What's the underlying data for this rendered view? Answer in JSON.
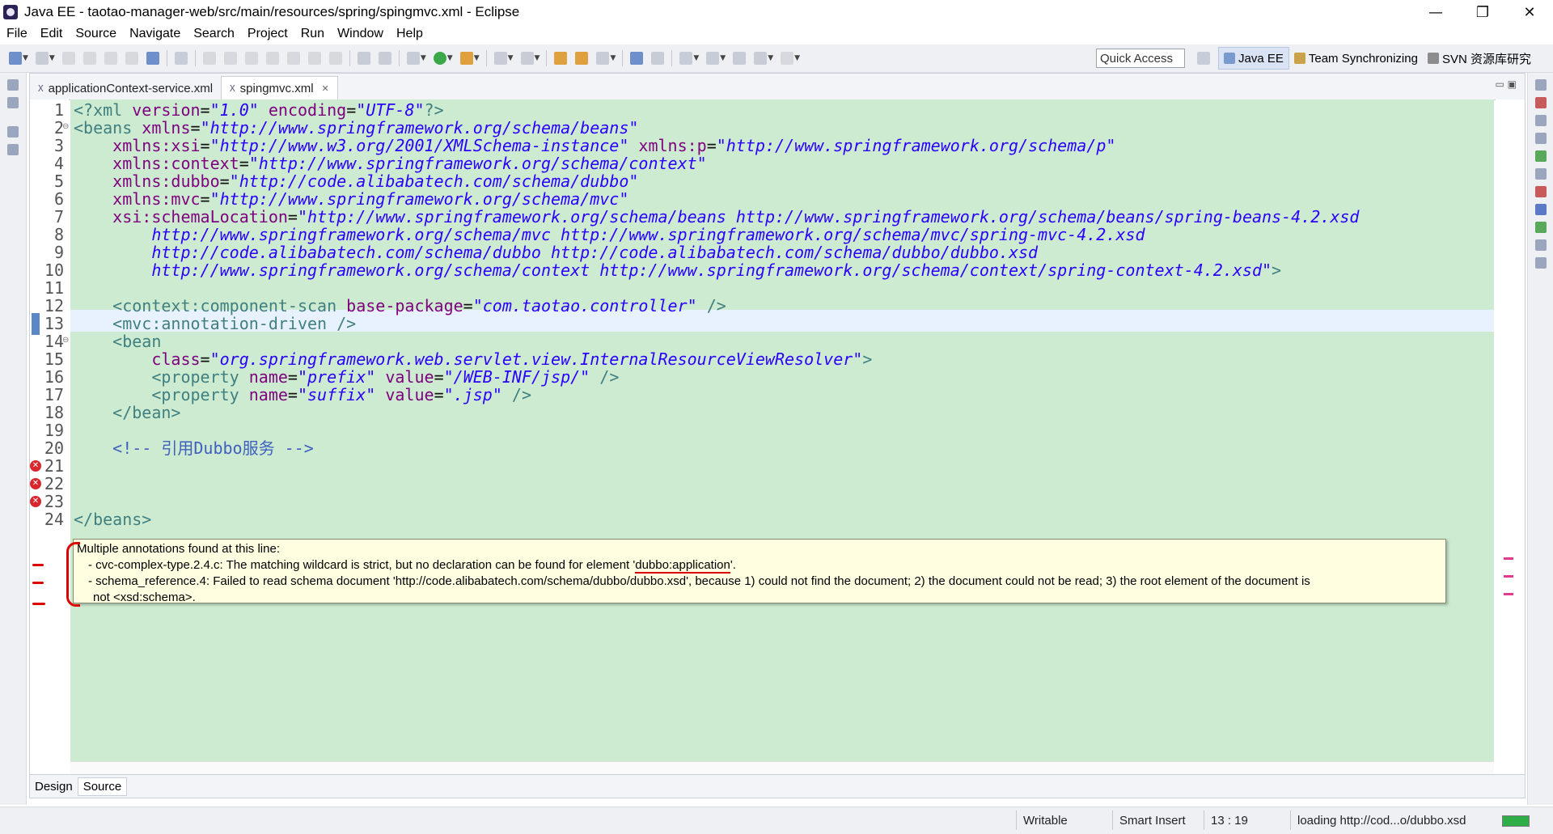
{
  "window": {
    "title": "Java EE - taotao-manager-web/src/main/resources/spring/spingmvc.xml - Eclipse",
    "controls": [
      "—",
      "❐",
      "✕"
    ]
  },
  "menu": [
    "File",
    "Edit",
    "Source",
    "Navigate",
    "Search",
    "Project",
    "Run",
    "Window",
    "Help"
  ],
  "toolbar": {
    "quick_access": "Quick Access",
    "perspectives": [
      {
        "label": "Java EE",
        "active": true
      },
      {
        "label": "Team Synchronizing",
        "active": false
      },
      {
        "label": "SVN 资源库研究",
        "active": false
      }
    ]
  },
  "editor": {
    "tabs": [
      {
        "label": "applicationContext-service.xml",
        "active": false
      },
      {
        "label": "spingmvc.xml",
        "active": true
      }
    ],
    "bottom_tabs": [
      "Design",
      "Source"
    ],
    "active_bottom_tab": "Source",
    "current_line": 13,
    "error_lines": [
      21,
      22,
      23
    ],
    "line_numbers": [
      "1",
      "2",
      "3",
      "4",
      "5",
      "6",
      "7",
      "8",
      "9",
      "10",
      "11",
      "12",
      "13",
      "14",
      "15",
      "16",
      "17",
      "18",
      "19",
      "20",
      "21",
      "22",
      "23",
      "24"
    ]
  },
  "code": {
    "l1": [
      "<?xml ",
      "version",
      "=",
      "\"1.0\"",
      " ",
      "encoding",
      "=",
      "\"UTF-8\"",
      "?>"
    ],
    "l2": [
      "<beans ",
      "xmlns",
      "=",
      "\"http://www.springframework.org/schema/beans\""
    ],
    "l3": [
      "    ",
      "xmlns:xsi",
      "=",
      "\"http://www.w3.org/2001/XMLSchema-instance\"",
      " ",
      "xmlns:p",
      "=",
      "\"http://www.springframework.org/schema/p\""
    ],
    "l4": [
      "    ",
      "xmlns:context",
      "=",
      "\"http://www.springframework.org/schema/context\""
    ],
    "l5": [
      "    ",
      "xmlns:dubbo",
      "=",
      "\"http://code.alibabatech.com/schema/dubbo\""
    ],
    "l6": [
      "    ",
      "xmlns:mvc",
      "=",
      "\"http://www.springframework.org/schema/mvc\""
    ],
    "l7": [
      "    ",
      "xsi:schemaLocation",
      "=",
      "\"http://www.springframework.org/schema/beans http://www.springframework.org/schema/beans/spring-beans-4.2.xsd"
    ],
    "l8": "        http://www.springframework.org/schema/mvc http://www.springframework.org/schema/mvc/spring-mvc-4.2.xsd",
    "l9": "        http://code.alibabatech.com/schema/dubbo http://code.alibabatech.com/schema/dubbo/dubbo.xsd",
    "l10": [
      "        http://www.springframework.org/schema/context http://www.springframework.org/schema/context/spring-context-4.2.xsd\"",
      ">"
    ],
    "l12": [
      "    <context:component-scan ",
      "base-package",
      "=",
      "\"com.taotao.controller\"",
      " />"
    ],
    "l13": "    <mvc:annotation-driven />",
    "l14": "    <bean",
    "l15": [
      "        ",
      "class",
      "=",
      "\"org.springframework.web.servlet.view.InternalResourceViewResolver\"",
      ">"
    ],
    "l16": [
      "        <property ",
      "name",
      "=",
      "\"prefix\"",
      " ",
      "value",
      "=",
      "\"/WEB-INF/jsp/\"",
      " />"
    ],
    "l17": [
      "        <property ",
      "name",
      "=",
      "\"suffix\"",
      " ",
      "value",
      "=",
      "\".jsp\"",
      " />"
    ],
    "l18": "    </bean>",
    "l20": "    <!-- 引用Dubbo服务 -->",
    "l24": "</beans>"
  },
  "tooltip": {
    "header": "Multiple annotations found at this line:",
    "item1_prefix": "- cvc-complex-type.2.4.c: The matching wildcard is strict, but no declaration can be found for element '",
    "item1_element": "dubbo:application",
    "item1_suffix": "'.",
    "item2_line1": "- schema_reference.4: Failed to read schema document 'http://code.alibabatech.com/schema/dubbo/dubbo.xsd', because 1) could not find the document; 2) the document could not be read; 3) the root element of the document is",
    "item2_line2": "not <xsd:schema>."
  },
  "status": {
    "writable": "Writable",
    "insert_mode": "Smart Insert",
    "position": "13 : 19",
    "loading": "loading http://cod...o/dubbo.xsd"
  },
  "colors": {
    "code_background": "#cdebd1",
    "current_line": "#e8f2fe",
    "tag": "#3f7f7f",
    "attribute": "#7f007f",
    "value": "#2a00ff",
    "comment": "#3f5fbf",
    "error": "#d8272d",
    "tooltip_background": "#fffee1",
    "annotation_red": "#dd0000"
  }
}
